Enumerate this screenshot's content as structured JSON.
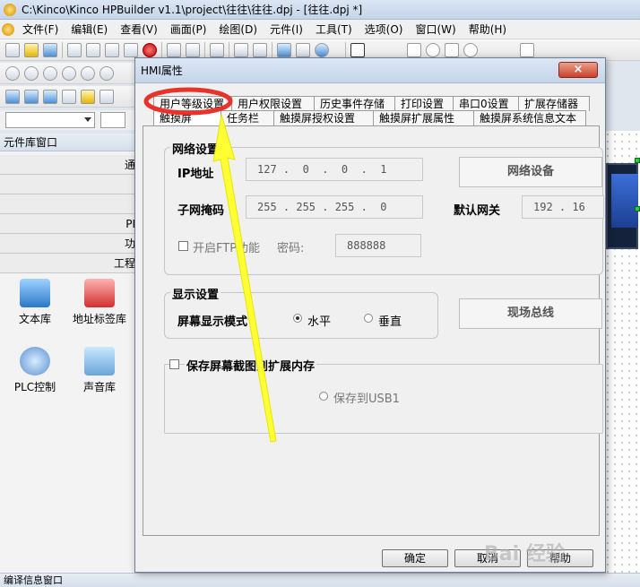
{
  "app": {
    "title": "C:\\Kinco\\Kinco HPBuilder v1.1\\project\\往往\\往往.dpj - [往往.dpj *]"
  },
  "menu": [
    "文件(F)",
    "编辑(E)",
    "查看(V)",
    "画面(P)",
    "绘图(D)",
    "元件(I)",
    "工具(T)",
    "选项(O)",
    "窗口(W)",
    "帮助(H)"
  ],
  "left_panel": {
    "title": "元件库窗口",
    "rows": [
      "通",
      "",
      "",
      "PI",
      "功",
      "工程"
    ],
    "libs": [
      {
        "label": "文本库",
        "icon": "text-library-icon"
      },
      {
        "label": "地址标签库",
        "icon": "address-tag-library-icon"
      },
      {
        "label": "PLC控制",
        "icon": "plc-control-icon"
      },
      {
        "label": "声音库",
        "icon": "sound-library-icon"
      }
    ],
    "bottom": "编译信息窗口"
  },
  "dialog": {
    "title": "HMI属性",
    "close": "×",
    "tabs_back": [
      "用户等级设置",
      "用户权限设置",
      "历史事件存储",
      "打印设置",
      "串口0设置",
      "扩展存储器"
    ],
    "tabs_front": [
      "触摸屏",
      "任务栏",
      "触摸屏授权设置",
      "触摸屏扩展属性",
      "触摸屏系统信息文本"
    ],
    "network": {
      "title": "网络设置",
      "ip_label": "IP地址",
      "ip_value": "127 .  0  .  0  .  1",
      "mask_label": "子网掩码",
      "mask_value": "255 . 255 . 255 .  0",
      "gateway_label": "默认网关",
      "gateway_value": "192 . 16",
      "ftp_label": "开启FTP功能",
      "password_label": "密码:",
      "password_value": "888888",
      "network_device_button": "网络设备"
    },
    "display": {
      "title": "显示设置",
      "mode_label": "屏幕显示模式",
      "horizontal": "水平",
      "vertical": "垂直",
      "fieldbus_button": "现场总线"
    },
    "save_screenshot": {
      "label": "保存屏幕截图到扩展内存",
      "usb_option": "保存到USB1"
    },
    "buttons": {
      "ok": "确定",
      "cancel": "取消",
      "help": "帮助"
    }
  },
  "watermark": "Bai 经验",
  "colors": {
    "highlight_circle": "#e8322a",
    "arrow": "#ffff33",
    "dialog_bg": "#f0f0f0"
  }
}
